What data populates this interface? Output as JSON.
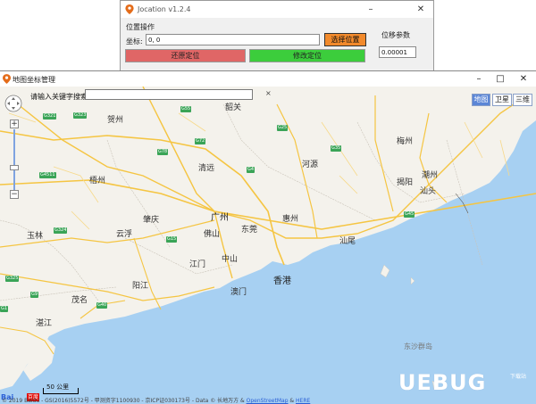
{
  "tool_window": {
    "title": "Jocation v1.2.4",
    "group_label": "位置操作",
    "coord_label": "坐标:",
    "coord_value": "0, 0",
    "select_button": "选择位置",
    "offset_label": "位移参数",
    "offset_value": "0.00001",
    "restore_button": "还原定位",
    "modify_button": "修改定位"
  },
  "map_window": {
    "title": "地图坐标管理",
    "search_label": "请输入关键字搜索",
    "search_value": "",
    "search_clear": "×",
    "zoom_in": "+",
    "zoom_out": "−",
    "map_types": [
      "地图",
      "卫星",
      "三维"
    ],
    "labels": {
      "guangzhou": "广州",
      "hongkong": "香港",
      "macau": "澳门",
      "dongguan": "东莞",
      "huizhou": "惠州",
      "zhongshan": "中山",
      "jiangmen": "江门",
      "foshan": "佛山",
      "zhaoqing": "肇庆",
      "qingyuan": "清远",
      "shaoguan": "韶关",
      "heyuan": "河源",
      "meizhou": "梅州",
      "shanwei": "汕尾",
      "jieyang": "揭阳",
      "chaozhou": "潮州",
      "shantou": "汕头",
      "yunfu": "云浮",
      "yangjiang": "阳江",
      "maoming": "茂名",
      "zhanjiang": "湛江",
      "yulin": "玉林",
      "wuzhou": "梧州",
      "hezhou": "贺州",
      "dongsha": "东沙群岛"
    },
    "road_badges": [
      "G321",
      "G323",
      "G55",
      "G4511",
      "G78",
      "G72",
      "G4",
      "G15",
      "G25",
      "G35",
      "G45",
      "G324",
      "G325",
      "G40",
      "G1",
      "G9"
    ],
    "scale_label": "50 公里",
    "baidu_logo": "Bai",
    "baidu_logo_red": "百度",
    "copyright_prefix": "© 2019 Baidu - GS(2016)5572号 - 甲测资字1100930 - 京ICP证030173号 - Data © 长地万方 & ",
    "copyright_osm": "OpenStreetMap",
    "copyright_amp": " & ",
    "copyright_here": "HERE",
    "watermark": "UEBUG",
    "watermark_sub": "下载站"
  },
  "colors": {
    "sea": "#a7d0f2",
    "land": "#f4f2ec",
    "road": "#f5c542",
    "select_button": "#f28a2c",
    "restore_button": "#e06666",
    "modify_button": "#3ccd3c"
  }
}
